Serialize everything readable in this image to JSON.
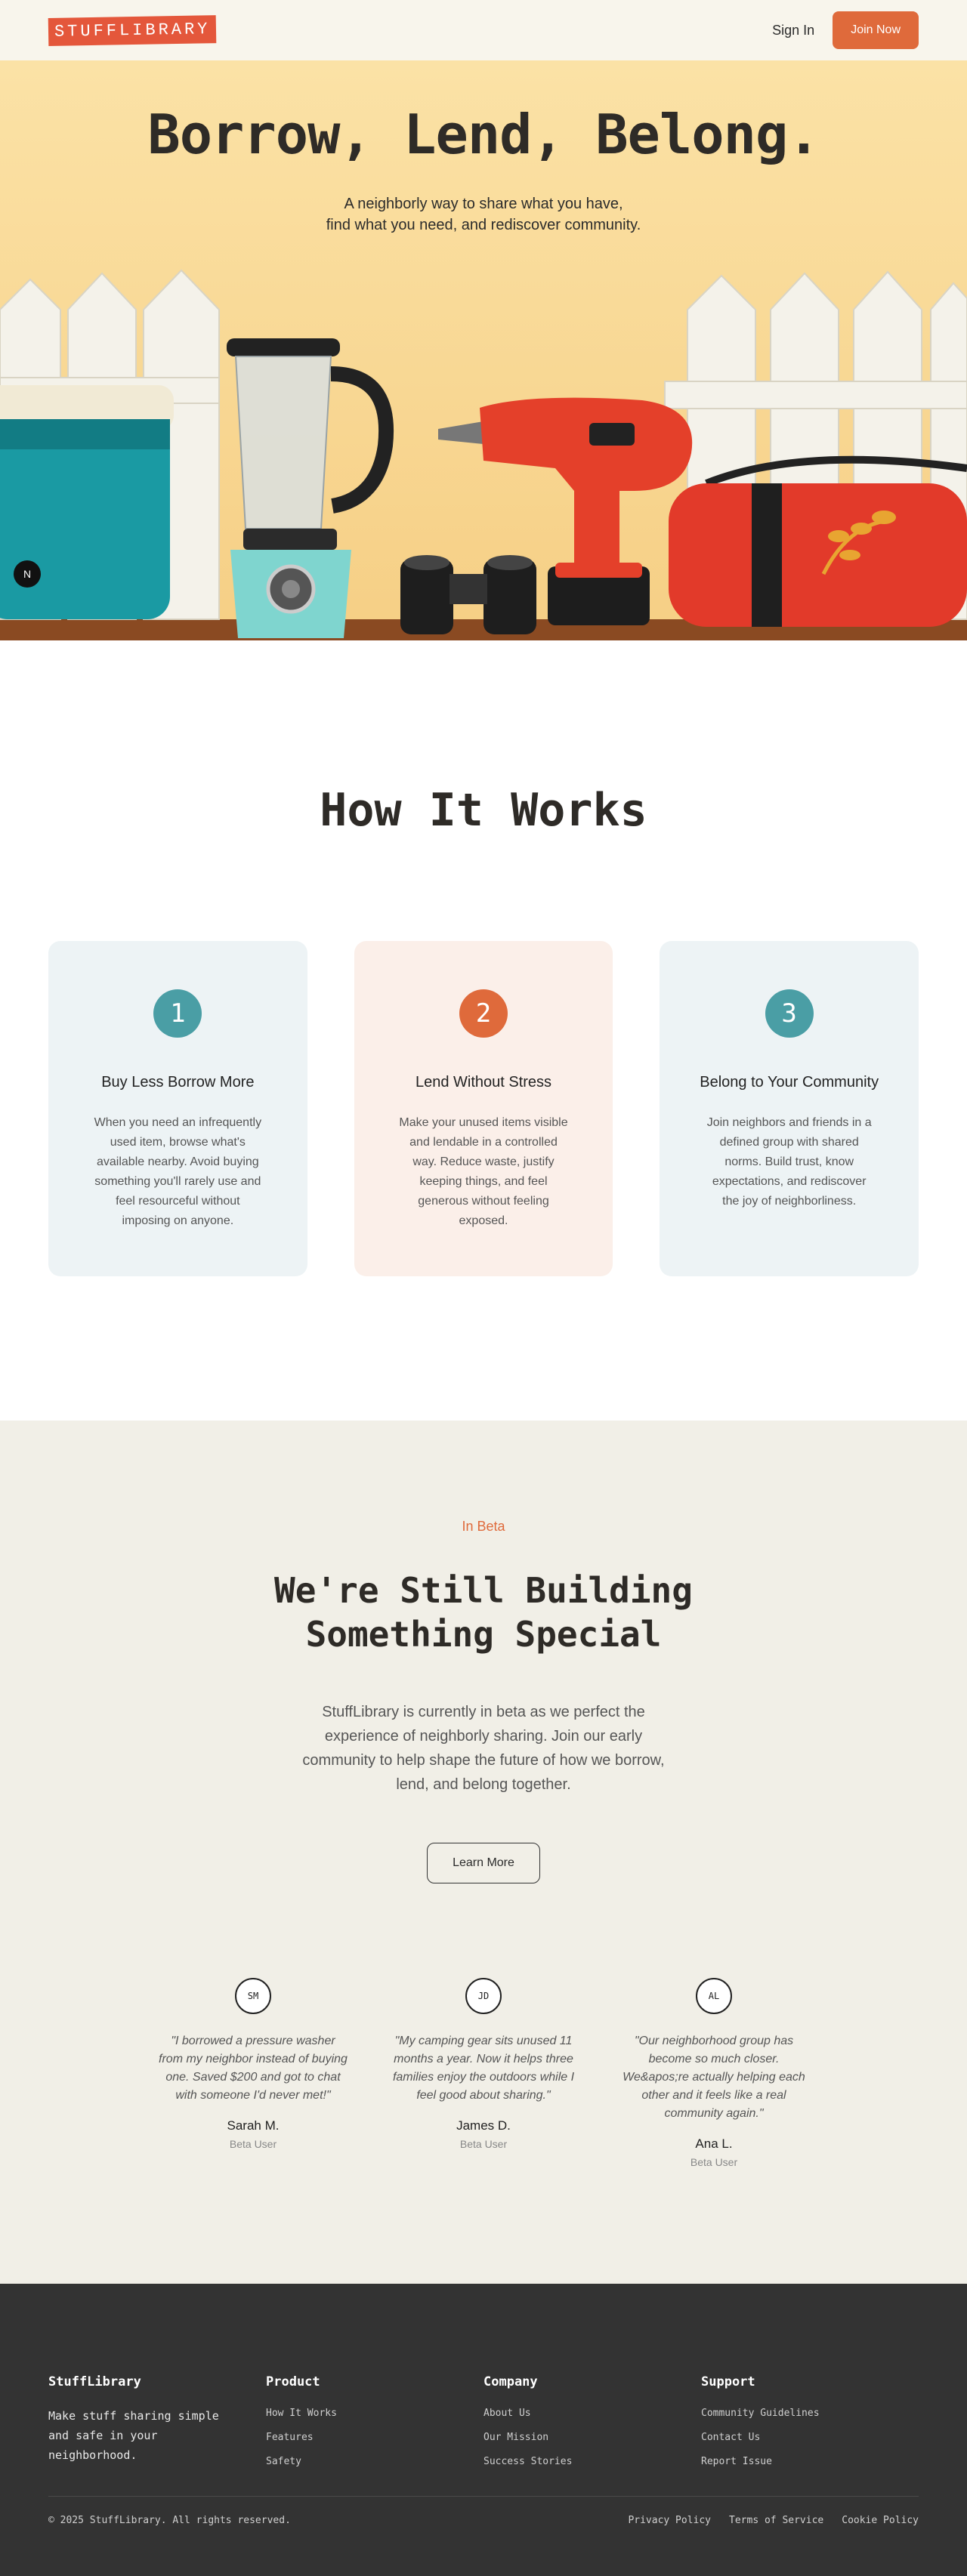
{
  "header": {
    "logo": "STUFFLIBRARY",
    "sign_in": "Sign In",
    "join": "Join Now"
  },
  "hero": {
    "title": "Borrow, Lend, Belong.",
    "subtitle_line1": "A neighborly way to share what you have,",
    "subtitle_line2": "find what you need, and rediscover community.",
    "badge": "N"
  },
  "how": {
    "title": "How It Works",
    "steps": [
      {
        "number": "1",
        "title": "Buy Less Borrow More",
        "text": "When you need an infrequently used item, browse what's available nearby. Avoid buying something you'll rarely use and feel resourceful without imposing on anyone."
      },
      {
        "number": "2",
        "title": "Lend Without Stress",
        "text": "Make your unused items visible and lendable in a controlled way. Reduce waste, justify keeping things, and feel generous without feeling exposed."
      },
      {
        "number": "3",
        "title": "Belong to Your Community",
        "text": "Join neighbors and friends in a defined group with shared norms. Build trust, know expectations, and rediscover the joy of neighborliness."
      }
    ]
  },
  "beta": {
    "tag": "In Beta",
    "title": "We're Still Building Something Special",
    "text": "StuffLibrary is currently in beta as we perfect the experience of neighborly sharing. Join our early community to help shape the future of how we borrow, lend, and belong together.",
    "button": "Learn More",
    "testimonials": [
      {
        "initials": "SM",
        "quote": "\"I borrowed a pressure washer from my neighbor instead of buying one. Saved $200 and got to chat with someone I'd never met!\"",
        "name": "Sarah M.",
        "role": "Beta User"
      },
      {
        "initials": "JD",
        "quote": "\"My camping gear sits unused 11 months a year. Now it helps three families enjoy the outdoors while I feel good about sharing.\"",
        "name": "James D.",
        "role": "Beta User"
      },
      {
        "initials": "AL",
        "quote": "\"Our neighborhood group has become so much closer. We&apos;re actually helping each other and it feels like a real community again.\"",
        "name": "Ana L.",
        "role": "Beta User"
      }
    ]
  },
  "footer": {
    "brand": "StuffLibrary",
    "tagline": "Make stuff sharing simple and safe in your neighborhood.",
    "product": {
      "title": "Product",
      "links": [
        "How It Works",
        "Features",
        "Safety"
      ]
    },
    "company": {
      "title": "Company",
      "links": [
        "About Us",
        "Our Mission",
        "Success Stories"
      ]
    },
    "support": {
      "title": "Support",
      "links": [
        "Community Guidelines",
        "Contact Us",
        "Report Issue"
      ]
    },
    "copyright": "© 2025 StuffLibrary. All rights reserved.",
    "legal": [
      "Privacy Policy",
      "Terms of Service",
      "Cookie Policy"
    ]
  }
}
